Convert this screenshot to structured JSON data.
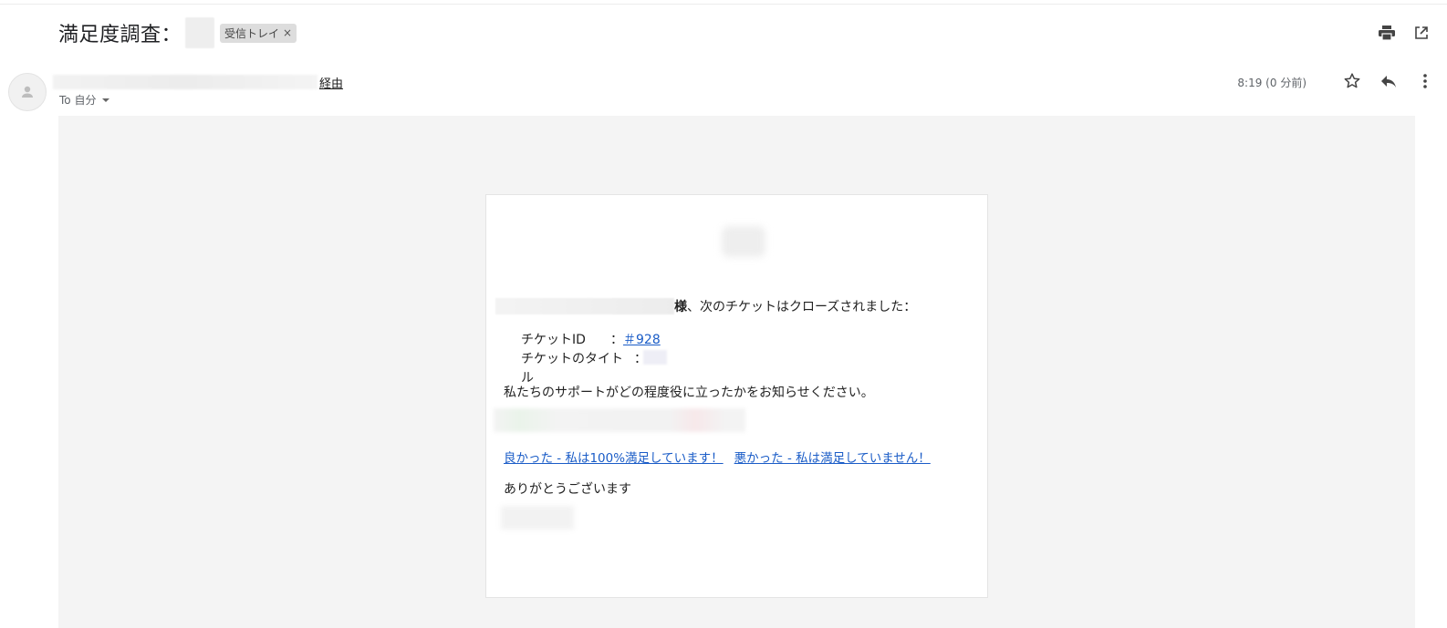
{
  "header": {
    "subject": "満足度調査：",
    "label_chip": "受信トレイ",
    "label_remove": "×"
  },
  "sender": {
    "via": "経由",
    "to_me": "To 自分",
    "timestamp": "8:19 (0 分前)"
  },
  "email": {
    "greeting_suffix": "様",
    "greeting_text": "、次のチケットはクローズされました：",
    "ticket_id_label": "チケットID",
    "ticket_id_colon": "：",
    "ticket_id_value": "＃928",
    "ticket_title_label": "チケットのタイトル",
    "ticket_title_colon": "：",
    "ask_text": "私たちのサポートがどの程度役に立ったかをお知らせください。",
    "good_link": "良かった - 私は100%満足しています！",
    "bad_link": "悪かった - 私は満足していません！",
    "thanks": "ありがとうございます"
  },
  "icons": {
    "print": "print-icon",
    "open_new_window": "open-in-new-window-icon",
    "star": "star-icon",
    "reply": "reply-icon",
    "more": "more-vert-icon",
    "avatar": "person-icon"
  }
}
